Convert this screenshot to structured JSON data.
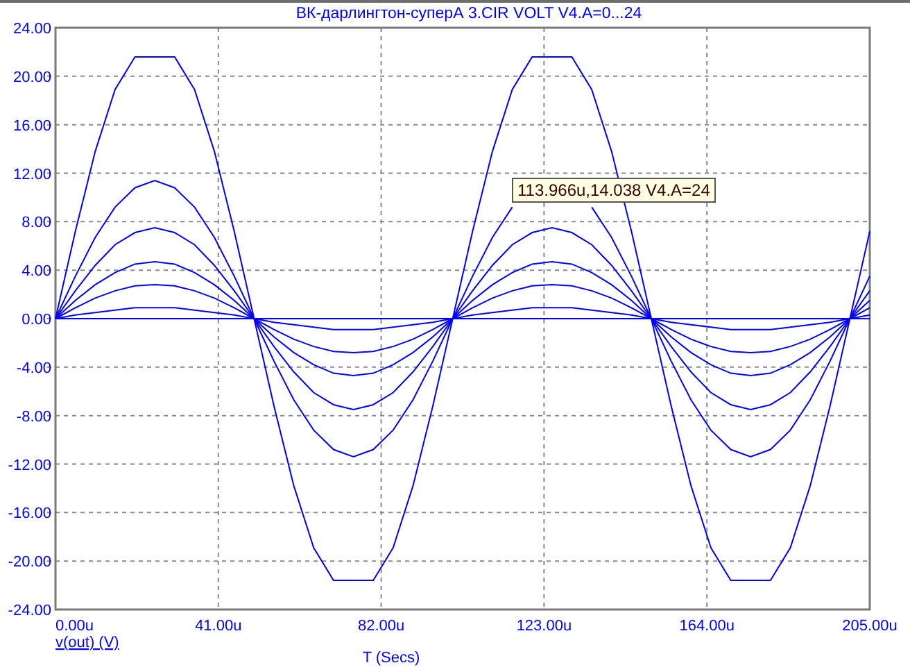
{
  "window": {
    "title": "ВК-дарлингтон-суперА 3.CIR VOLT V4.A=0...24"
  },
  "plot": {
    "chart_data": {
      "type": "line",
      "xlabel": "T (Secs)",
      "grid": true,
      "xlim": [
        0,
        205
      ],
      "ylim": [
        -24,
        24
      ],
      "xticks": [
        {
          "value": 0,
          "label": "0.00u"
        },
        {
          "value": 41,
          "label": "41.00u"
        },
        {
          "value": 82,
          "label": "82.00u"
        },
        {
          "value": 123,
          "label": "123.00u"
        },
        {
          "value": 164,
          "label": "164.00u"
        },
        {
          "value": 205,
          "label": "205.00u"
        }
      ],
      "yticks": [
        {
          "value": 24,
          "label": "24.00"
        },
        {
          "value": 20,
          "label": "20.00"
        },
        {
          "value": 16,
          "label": "16.00"
        },
        {
          "value": 12,
          "label": "12.00"
        },
        {
          "value": 8,
          "label": "8.00"
        },
        {
          "value": 4,
          "label": "4.00"
        },
        {
          "value": 0,
          "label": "0.00"
        },
        {
          "value": -4,
          "label": "-4.00"
        },
        {
          "value": -8,
          "label": "-8.00"
        },
        {
          "value": -12,
          "label": "-12.00"
        },
        {
          "value": -16,
          "label": "-16.00"
        },
        {
          "value": -20,
          "label": "-20.00"
        },
        {
          "value": -24,
          "label": "-24.00"
        }
      ],
      "x": [
        0,
        5,
        10,
        15,
        20,
        25,
        30,
        35,
        40,
        45,
        50,
        55,
        60,
        65,
        70,
        75,
        80,
        85,
        90,
        95,
        100,
        105,
        110,
        115,
        120,
        125,
        130,
        135,
        140,
        145,
        150,
        155,
        160,
        165,
        170,
        175,
        180,
        185,
        190,
        195,
        200,
        205
      ],
      "series": [
        {
          "color": "#0000ff",
          "values": [
            0,
            7.2,
            13.8,
            18.9,
            21.6,
            21.6,
            21.6,
            18.9,
            13.8,
            7.2,
            0,
            -7.2,
            -13.8,
            -18.9,
            -21.6,
            -21.6,
            -21.6,
            -18.9,
            -13.8,
            -7.2,
            0,
            7.2,
            13.8,
            18.9,
            21.6,
            21.6,
            21.6,
            18.9,
            13.8,
            7.2,
            0,
            -7.2,
            -13.8,
            -18.9,
            -21.6,
            -21.6,
            -21.6,
            -18.9,
            -13.8,
            -7.2,
            0,
            7.2
          ]
        },
        {
          "color": "#0000ff",
          "values": [
            0,
            3.5,
            6.7,
            9.2,
            10.8,
            11.4,
            10.8,
            9.2,
            6.7,
            3.5,
            0,
            -3.5,
            -6.7,
            -9.2,
            -10.8,
            -11.4,
            -10.8,
            -9.2,
            -6.7,
            -3.5,
            0,
            3.5,
            6.7,
            9.2,
            null,
            null,
            null,
            9.2,
            6.7,
            3.5,
            0,
            -3.5,
            -6.7,
            -9.2,
            -10.8,
            -11.4,
            -10.8,
            -9.2,
            -6.7,
            -3.5,
            0,
            3.5
          ]
        },
        {
          "color": "#0000ff",
          "values": [
            0,
            2.3,
            4.4,
            6.1,
            7.1,
            7.5,
            7.1,
            6.1,
            4.4,
            2.3,
            0,
            -2.3,
            -4.4,
            -6.1,
            -7.1,
            -7.5,
            -7.1,
            -6.1,
            -4.4,
            -2.3,
            0,
            2.3,
            4.4,
            6.1,
            7.1,
            7.5,
            7.1,
            6.1,
            4.4,
            2.3,
            0,
            -2.3,
            -4.4,
            -6.1,
            -7.1,
            -7.5,
            -7.1,
            -6.1,
            -4.4,
            -2.3,
            0,
            2.3
          ]
        },
        {
          "color": "#0000ff",
          "values": [
            0,
            1.5,
            2.8,
            3.8,
            4.5,
            4.7,
            4.5,
            3.8,
            2.8,
            1.5,
            0,
            -1.5,
            -2.8,
            -3.8,
            -4.5,
            -4.7,
            -4.5,
            -3.8,
            -2.8,
            -1.5,
            0,
            1.5,
            2.8,
            3.8,
            4.5,
            4.7,
            4.5,
            3.8,
            2.8,
            1.5,
            0,
            -1.5,
            -2.8,
            -3.8,
            -4.5,
            -4.7,
            -4.5,
            -3.8,
            -2.8,
            -1.5,
            0,
            1.5
          ]
        },
        {
          "color": "#0000ff",
          "values": [
            0,
            0.9,
            1.7,
            2.3,
            2.7,
            2.8,
            2.7,
            2.3,
            1.7,
            0.9,
            0,
            -0.9,
            -1.7,
            -2.3,
            -2.7,
            -2.8,
            -2.7,
            -2.3,
            -1.7,
            -0.9,
            0,
            0.9,
            1.7,
            2.3,
            2.7,
            2.8,
            2.7,
            2.3,
            1.7,
            0.9,
            0,
            -0.9,
            -1.7,
            -2.3,
            -2.7,
            -2.8,
            -2.7,
            -2.3,
            -1.7,
            -0.9,
            0,
            0.9
          ]
        },
        {
          "color": "#0000ff",
          "values": [
            0,
            0.3,
            0.5,
            0.7,
            0.9,
            0.9,
            0.9,
            0.7,
            0.5,
            0.3,
            0,
            -0.3,
            -0.5,
            -0.7,
            -0.9,
            -0.9,
            -0.9,
            -0.7,
            -0.5,
            -0.3,
            0,
            0.3,
            0.5,
            0.7,
            0.9,
            0.9,
            0.9,
            0.7,
            0.5,
            0.3,
            0,
            -0.3,
            -0.5,
            -0.7,
            -0.9,
            -0.9,
            -0.9,
            -0.7,
            -0.5,
            -0.3,
            0,
            0.3
          ]
        },
        {
          "color": "#0000ff",
          "values": [
            0,
            0,
            0,
            0,
            0,
            0,
            0,
            0,
            0,
            0,
            0,
            0,
            0,
            0,
            0,
            0,
            0,
            0,
            0,
            0,
            0,
            0,
            0,
            0,
            0,
            0,
            0,
            0,
            0,
            0,
            0,
            0,
            0,
            0,
            0,
            0,
            0,
            0,
            0,
            0,
            0,
            0
          ]
        }
      ]
    },
    "trace_label": "v(out) (V)",
    "cursor_readout": {
      "text": "113.966u,14.038 V4.A=24"
    }
  }
}
